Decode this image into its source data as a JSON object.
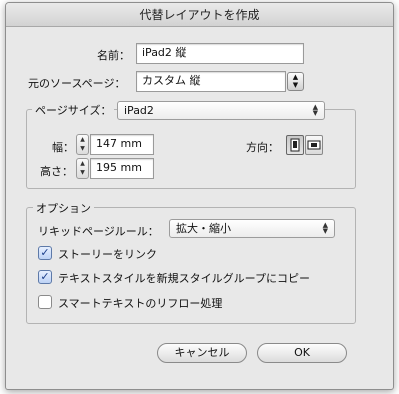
{
  "dialog": {
    "title": "代替レイアウトを作成"
  },
  "name": {
    "label": "名前：",
    "value": "iPad2 縦"
  },
  "source_page": {
    "label": "元のソースページ：",
    "value": "カスタム 縦"
  },
  "page_size": {
    "group_label": "ページサイズ：",
    "value": "iPad2",
    "width_label": "幅：",
    "width_value": "147 mm",
    "height_label": "高さ：",
    "height_value": "195 mm",
    "orientation_label": "方向："
  },
  "options": {
    "group_label": "オプション",
    "liquid_rule_label": "リキッドページルール：",
    "liquid_rule_value": "拡大・縮小",
    "checkboxes": [
      {
        "label": "ストーリーをリンク",
        "checked": true
      },
      {
        "label": "テキストスタイルを新規スタイルグループにコピー",
        "checked": true
      },
      {
        "label": "スマートテキストのリフロー処理",
        "checked": false
      }
    ]
  },
  "buttons": {
    "cancel": "キャンセル",
    "ok": "OK"
  },
  "glyphs": {
    "popup_arrows": "▲▼",
    "stepper_up": "▲",
    "stepper_down": "▼",
    "check": "✓"
  },
  "colors": {
    "dialog_bg": "#e8e8e8",
    "check_blue": "#1c3f8a"
  }
}
